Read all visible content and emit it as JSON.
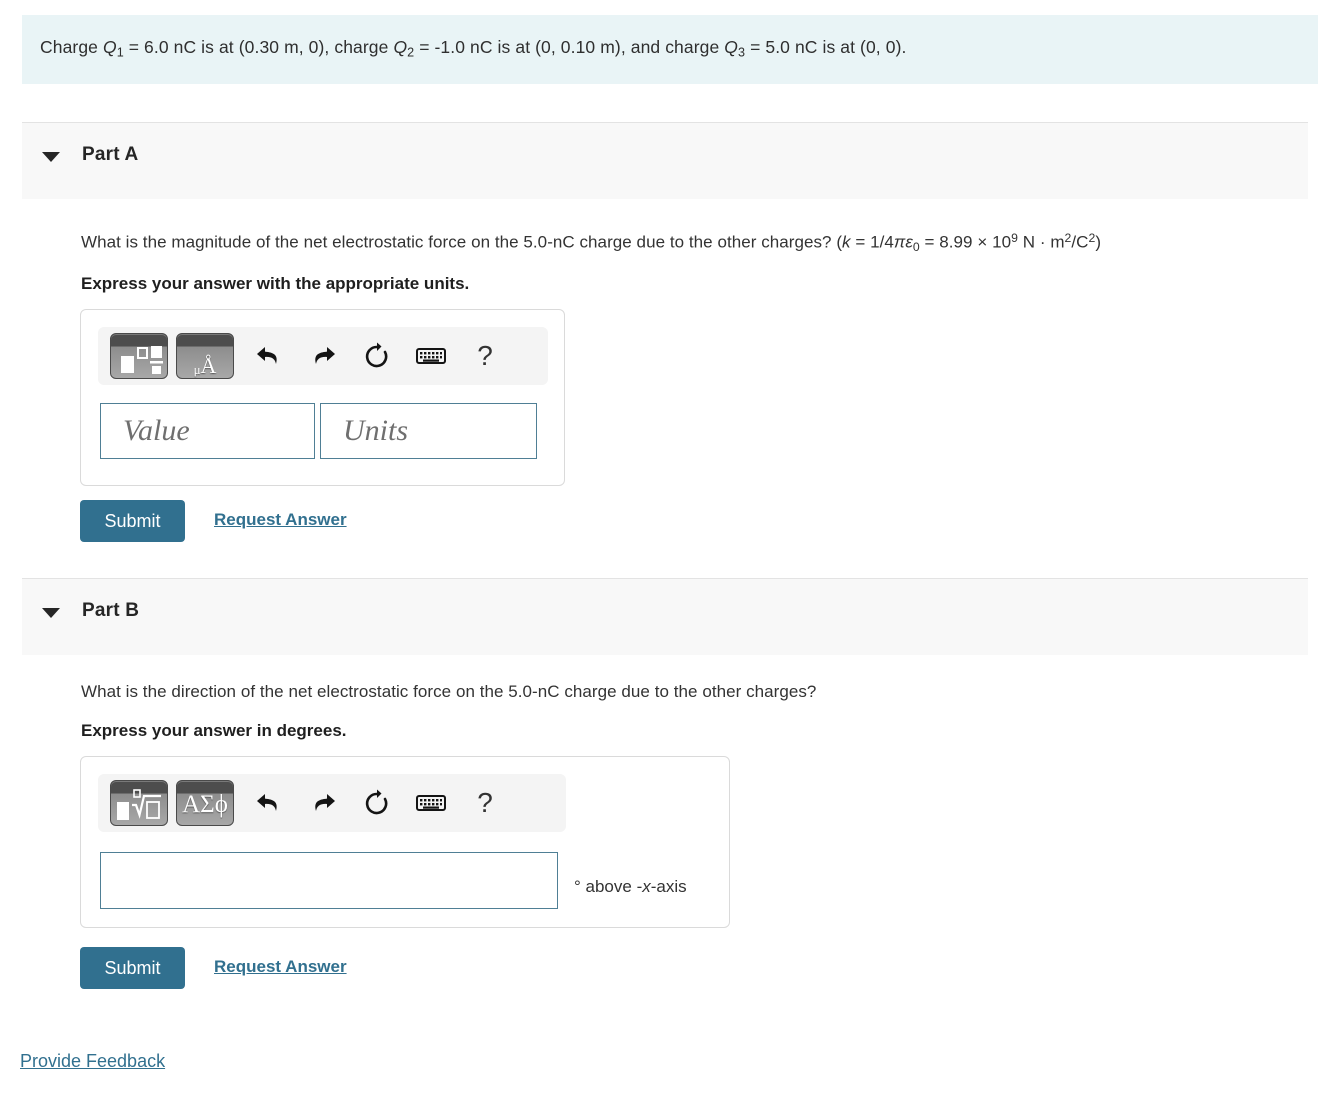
{
  "statement": {
    "prefix_1": "Charge ",
    "q1_sym": "Q",
    "q1_sub": "1",
    "mid_1": " = 6.0 nC is at (0.30 m, 0), charge ",
    "q2_sym": "Q",
    "q2_sub": "2",
    "mid_2": " = -1.0 nC is at (0, 0.10 m), and charge ",
    "q3_sym": "Q",
    "q3_sub": "3",
    "suffix": " = 5.0 nC is at (0, 0)."
  },
  "parts": {
    "a": {
      "title": "Part A",
      "caret_icon": "caret-down-icon",
      "question_main": "What is the magnitude of the net electrostatic force on the 5.0-nC charge due to the other charges? (",
      "question_k": "k",
      "question_eq1": " = 1/4",
      "question_pi_eps": "πε",
      "question_eps_sub": "0",
      "question_eq2": " = 8.99 × 10",
      "question_exp": "9",
      "question_units_1": " N · m",
      "question_units_exp1": "2",
      "question_units_2": "/C",
      "question_units_exp2": "2",
      "question_close": ")",
      "instruction": "Express your answer with the appropriate units.",
      "toolbar": {
        "template_icon": "math-template-icon",
        "units_icon": "units-icon",
        "units_label_mu": "μ",
        "units_label_a": "Å",
        "undo_icon": "undo-icon",
        "redo_icon": "redo-icon",
        "reset_icon": "reset-icon",
        "keyboard_icon": "keyboard-icon",
        "help_icon": "help-icon",
        "help_label": "?"
      },
      "value_placeholder": "Value",
      "units_placeholder": "Units",
      "value_input": "",
      "units_input": "",
      "submit_label": "Submit",
      "request_label": "Request Answer"
    },
    "b": {
      "title": "Part B",
      "caret_icon": "caret-down-icon",
      "question": "What is the direction of the net electrostatic force on the 5.0-nC charge due to the other charges?",
      "instruction": "Express your answer in degrees.",
      "toolbar": {
        "template_icon": "math-template-sqrt-icon",
        "greek_icon": "greek-letters-icon",
        "greek_label": "ΑΣϕ",
        "undo_icon": "undo-icon",
        "redo_icon": "redo-icon",
        "reset_icon": "reset-icon",
        "keyboard_icon": "keyboard-icon",
        "help_icon": "help-icon",
        "help_label": "?"
      },
      "answer_input": "",
      "suffix_deg": "° above -",
      "suffix_x": "x",
      "suffix_axis": "-axis",
      "submit_label": "Submit",
      "request_label": "Request Answer"
    }
  },
  "footer": {
    "feedback_label": "Provide Feedback"
  },
  "colors": {
    "banner_bg": "#e9f4f6",
    "part_header_bg": "#f8f8f8",
    "accent": "#31708f",
    "field_border": "#4f7f95"
  }
}
